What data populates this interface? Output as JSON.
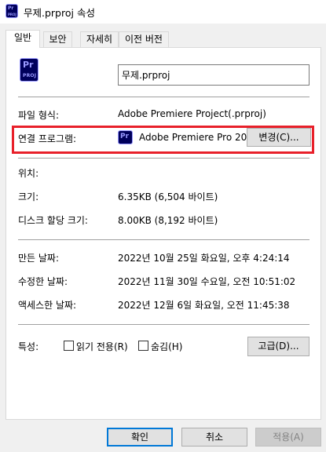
{
  "window": {
    "title": "무제.prproj 속성",
    "title_icon": "premiere-file-icon"
  },
  "tabs": [
    {
      "label": "일반",
      "active": true
    },
    {
      "label": "보안",
      "active": false
    },
    {
      "label": "자세히",
      "active": false
    },
    {
      "label": "이전 버전",
      "active": false
    }
  ],
  "general": {
    "file_icon": "premiere-file-icon",
    "filename": "무제.prproj",
    "file_type_label": "파일 형식:",
    "file_type_value": "Adobe Premiere Project(.prproj)",
    "opens_with_label": "연결 프로그램:",
    "opens_with_icon": "premiere-pro-icon",
    "opens_with_value": "Adobe Premiere Pro 20",
    "change_button": "변경(C)...",
    "location_label": "위치:",
    "location_value": "",
    "size_label": "크기:",
    "size_value": "6.35KB (6,504 바이트)",
    "size_on_disk_label": "디스크 할당 크기:",
    "size_on_disk_value": "8.00KB (8,192 바이트)",
    "created_label": "만든 날짜:",
    "created_value": "2022년 10월 25일 화요일, 오후 4:24:14",
    "modified_label": "수정한 날짜:",
    "modified_value": "2022년 11월 30일 수요일, 오전 10:51:02",
    "accessed_label": "액세스한 날짜:",
    "accessed_value": "2022년 12월 6일 화요일, 오전 11:45:38",
    "attributes_label": "특성:",
    "readonly_label": "읽기 전용(R)",
    "hidden_label": "숨김(H)",
    "advanced_button": "고급(D)..."
  },
  "footer": {
    "ok": "확인",
    "cancel": "취소",
    "apply": "적용(A)"
  },
  "colors": {
    "highlight": "#e8202a",
    "premiere_bg": "#00005b",
    "premiere_fg": "#9999ff",
    "focus_border": "#0078d7"
  }
}
